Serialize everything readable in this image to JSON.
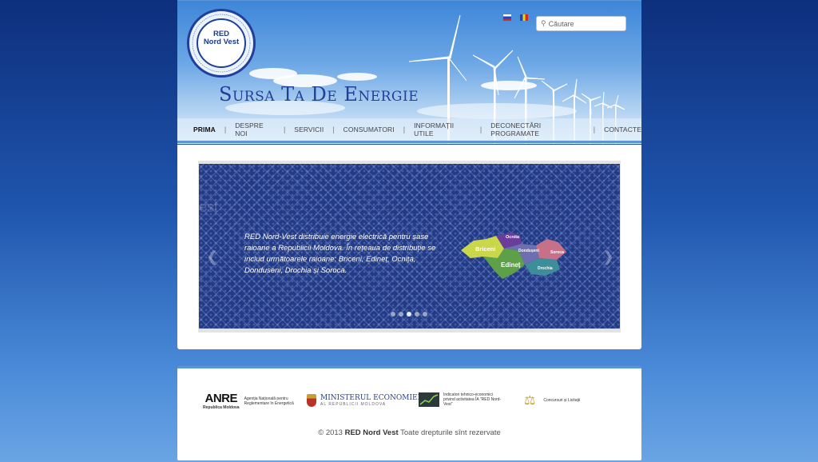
{
  "header": {
    "logo_text_line1": "RED",
    "logo_text_line2": "Nord Vest",
    "slogan": "Sursa Ta De Energie",
    "languages": [
      {
        "name": "ru-flag-icon",
        "label": "Russian"
      },
      {
        "name": "md-flag-icon",
        "label": "Moldovan"
      }
    ],
    "search": {
      "placeholder": "Căutare",
      "icon": "search-icon"
    }
  },
  "nav": {
    "items": [
      {
        "label": "Prima",
        "active": true
      },
      {
        "label": "Despre noi",
        "active": false
      },
      {
        "label": "Servicii",
        "active": false
      },
      {
        "label": "Consumatori",
        "active": false
      },
      {
        "label": "Informații utile",
        "active": false
      },
      {
        "label": "Deconectări programate",
        "active": false
      },
      {
        "label": "Contacte",
        "active": false
      }
    ]
  },
  "slider": {
    "text": "RED Nord-Vest distribuie energie electrică pentru șase raioane a Republicii Moldova. În rețeaua de distribuție se includ următoarele raioane: Briceni, Edineț, Ocnița, Donduseni, Drochia și Soroca.",
    "map_labels": [
      "Briceni",
      "Ocnita",
      "Dondușeni",
      "Edineț",
      "Soroca",
      "Drochia"
    ],
    "dots_total": 5,
    "active_dot": 3,
    "prev_icon": "chevron-left-icon",
    "next_icon": "chevron-right-icon"
  },
  "footer": {
    "partners": [
      {
        "logo": "ANRE",
        "sub": "Republica Moldova",
        "text": "Agenția Națională pentru Reglementare în Energetică"
      },
      {
        "logo": "MINISTERUL ECONOMIEI",
        "sub": "AL REPUBLICII MOLDOVA"
      },
      {
        "text": "Indicatori tehnico-economici privind activitatea ÎA \"RED Nord-Vest\""
      },
      {
        "text": "Concursuri și Licitații"
      }
    ],
    "copyright_prefix": "© 2013",
    "copyright_brand": "RED Nord Vest",
    "copyright_suffix": "Toate drepturile sînt rezervate"
  }
}
